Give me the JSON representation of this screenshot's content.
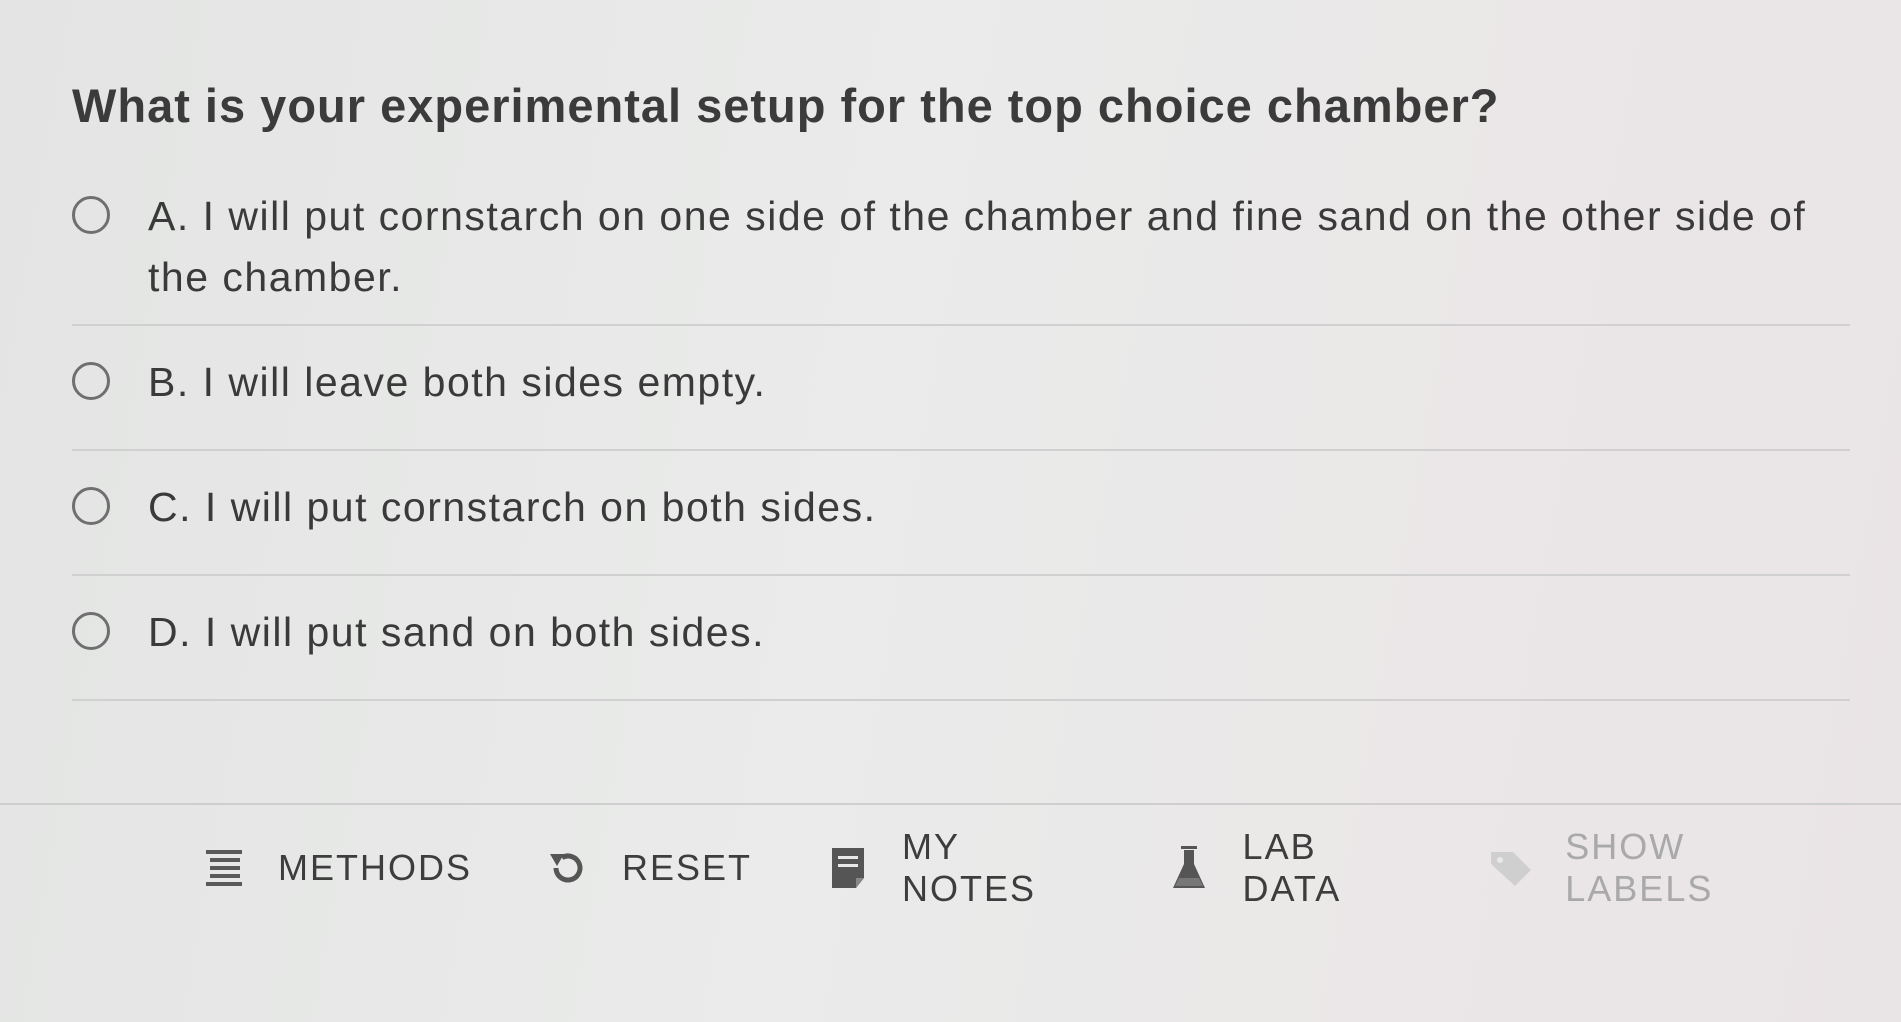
{
  "question": {
    "text": "What is your experimental setup for the top choice chamber?"
  },
  "options": [
    {
      "label": "A. I will put cornstarch on one side of the chamber and fine sand on the other side of the chamber."
    },
    {
      "label": "B. I will leave both sides empty."
    },
    {
      "label": "C. I will put cornstarch on both sides."
    },
    {
      "label": "D. I will put sand on both sides."
    }
  ],
  "toolbar": {
    "methods": {
      "label": "METHODS",
      "icon": "list-icon"
    },
    "reset": {
      "label": "RESET",
      "icon": "reset-icon"
    },
    "notes": {
      "label": "MY NOTES",
      "icon": "notepad-icon"
    },
    "labdata": {
      "label": "LAB DATA",
      "icon": "flask-icon"
    },
    "showlabels": {
      "label": "SHOW LABELS",
      "icon": "tag-icon"
    }
  },
  "colors": {
    "text": "#3a3a3a",
    "muted": "#a9a9a9",
    "divider": "#cfd0cf"
  }
}
